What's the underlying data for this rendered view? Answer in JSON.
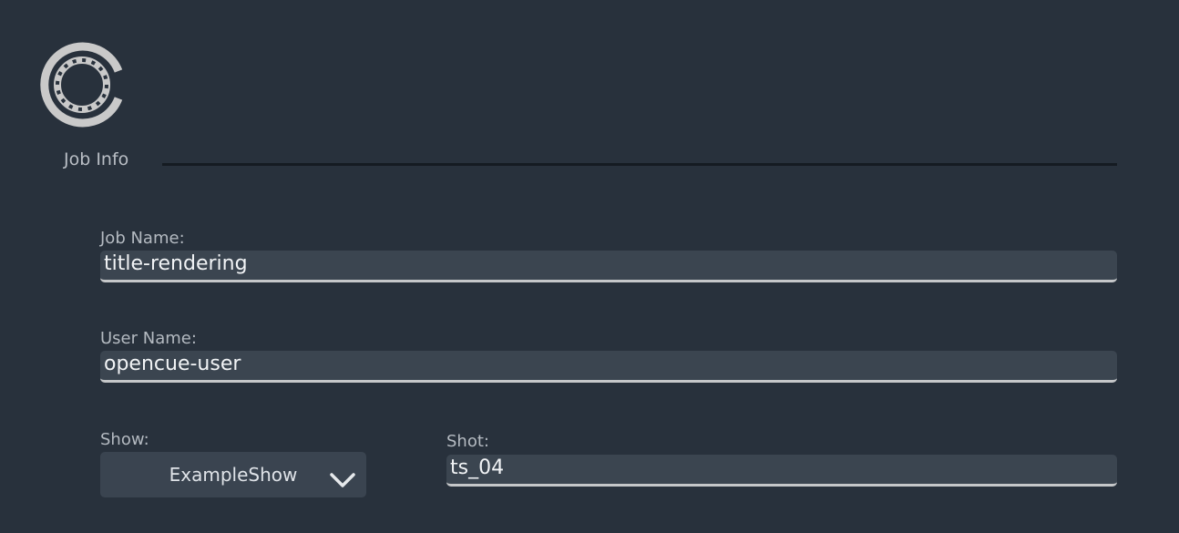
{
  "section": {
    "title": "Job Info"
  },
  "logo": {
    "icon": "opencue-logo-icon"
  },
  "job_name": {
    "label": "Job Name:",
    "value": "title-rendering"
  },
  "user_name": {
    "label": "User Name:",
    "value": "opencue-user"
  },
  "show": {
    "label": "Show:",
    "selected": "ExampleShow",
    "icon": "chevron-down-icon"
  },
  "shot": {
    "label": "Shot:",
    "value": "ts_04"
  },
  "colors": {
    "background": "#28313c",
    "field_background": "#3b4550",
    "field_underline": "#c5c7c9",
    "divider": "#151b22",
    "text": "#f2f4f6",
    "label": "#b4bac1"
  }
}
